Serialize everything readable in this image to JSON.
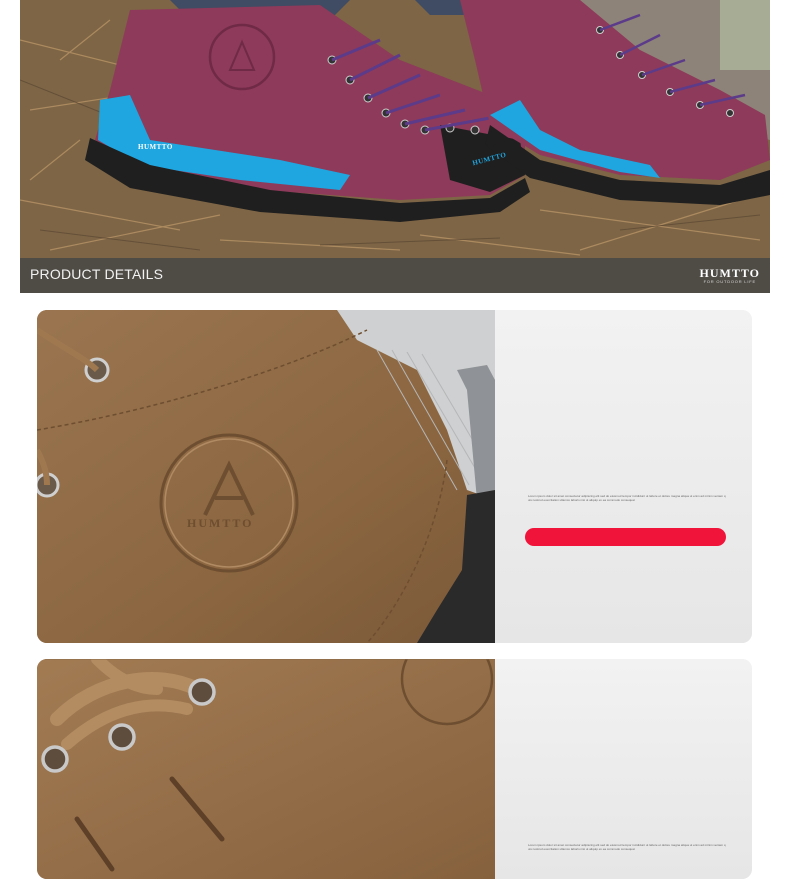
{
  "hero": {
    "section_title": "PRODUCT DETAILS",
    "brand_name": "HUMTTO",
    "brand_tagline": "FOR OUTDOOR LIFE",
    "shoe_logo_text": "HUMTTO"
  },
  "detail_cards": [
    {
      "logo_text": "HUMTTO",
      "description": "Lorem ipsum dolor sit amet consectetur adipiscing elit sed do eiusmod tempor incididunt ut labore et dolore magna aliqua ut enim ad minim veniam quis nostrud exercitation ullamco laboris nisi ut aliquip ex ea commodo consequat",
      "button_label": ""
    },
    {
      "description": "Lorem ipsum dolor sit amet consectetur adipiscing elit sed do eiusmod tempor incididunt ut labore et dolore magna aliqua ut enim ad minim veniam quis nostrud exercitation ullamco laboris nisi ut aliquip ex ea commodo consequat"
    }
  ],
  "colors": {
    "accent_red": "#f0143a",
    "shoe_purple": "#8e3a5a",
    "shoe_blue": "#1fa6e0",
    "leather_brown": "#8f6a45"
  }
}
